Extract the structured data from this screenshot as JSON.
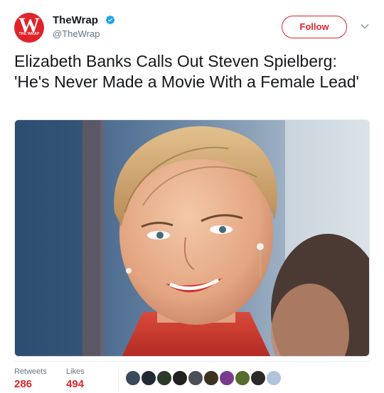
{
  "account": {
    "name": "TheWrap",
    "handle": "@TheWrap",
    "avatar_letter": "W",
    "avatar_subtext": "THE WRAP",
    "verified_icon": "verified-badge-icon",
    "brand_color": "#e0232a"
  },
  "actions": {
    "follow_label": "Follow",
    "more_icon": "chevron-down-icon"
  },
  "tweet": {
    "text": "Elizabeth Banks Calls Out Steven Spielberg: 'He's Never Made a Movie With a Female Lead'"
  },
  "stats": {
    "retweets_label": "Retweets",
    "retweets_value": "286",
    "likes_label": "Likes",
    "likes_value": "494"
  },
  "likers": [
    {
      "name": "liker-avatar-1",
      "color": "#3a4a5c"
    },
    {
      "name": "liker-avatar-2",
      "color": "#1f2a33"
    },
    {
      "name": "liker-avatar-3",
      "color": "#2c3a2a"
    },
    {
      "name": "liker-avatar-4",
      "color": "#222222"
    },
    {
      "name": "liker-avatar-5",
      "color": "#4a4f58"
    },
    {
      "name": "liker-avatar-6",
      "color": "#3b3320"
    },
    {
      "name": "liker-avatar-7",
      "color": "#7a3a8c"
    },
    {
      "name": "liker-avatar-8",
      "color": "#556b2f"
    },
    {
      "name": "liker-avatar-9",
      "color": "#2a2a2a"
    },
    {
      "name": "liker-avatar-10",
      "color": "#b0c4de"
    }
  ]
}
